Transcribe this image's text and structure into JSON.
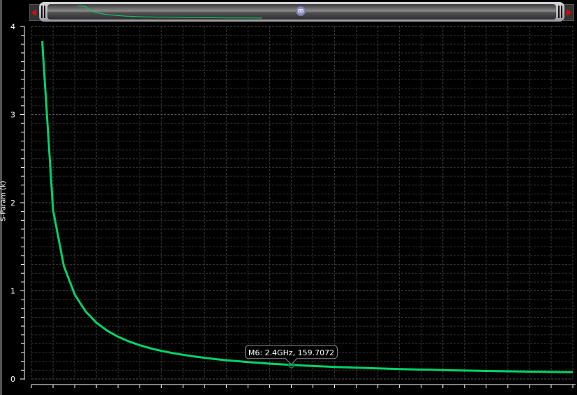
{
  "chart_data": {
    "type": "line",
    "title": "",
    "xlabel": "",
    "ylabel": "S-Param (k)",
    "xlim": [
      0,
      5
    ],
    "xunit": "GHz",
    "ylim": [
      0,
      4
    ],
    "yticks": [
      "0",
      "1",
      "2",
      "3",
      "4"
    ],
    "grid": true,
    "series": [
      {
        "name": "S-Param",
        "color": "#00d46a",
        "x": [
          0.1,
          0.2,
          0.3,
          0.4,
          0.5,
          0.6,
          0.7,
          0.8,
          0.9,
          1.0,
          1.1,
          1.2,
          1.3,
          1.4,
          1.5,
          1.6,
          1.7,
          1.8,
          1.9,
          2.0,
          2.1,
          2.2,
          2.3,
          2.4,
          2.5,
          2.6,
          2.7,
          2.8,
          2.9,
          3.0,
          3.1,
          3.2,
          3.3,
          3.4,
          3.5,
          3.6,
          3.7,
          3.8,
          3.9,
          4.0,
          4.1,
          4.2,
          4.3,
          4.4,
          4.5,
          4.6,
          4.7,
          4.8,
          4.9,
          5.0
        ],
        "values": [
          3.833,
          1.917,
          1.278,
          0.958,
          0.767,
          0.639,
          0.548,
          0.479,
          0.426,
          0.383,
          0.348,
          0.319,
          0.295,
          0.274,
          0.256,
          0.24,
          0.225,
          0.213,
          0.202,
          0.192,
          0.183,
          0.174,
          0.167,
          0.16,
          0.153,
          0.147,
          0.142,
          0.137,
          0.132,
          0.128,
          0.124,
          0.12,
          0.116,
          0.113,
          0.11,
          0.106,
          0.104,
          0.101,
          0.098,
          0.096,
          0.094,
          0.091,
          0.089,
          0.087,
          0.085,
          0.083,
          0.082,
          0.08,
          0.078,
          0.077
        ]
      }
    ],
    "marker": {
      "name": "M6",
      "x": 2.4,
      "y": 0.1597072,
      "label": "M6: 2.4GHz, 159.7072"
    }
  },
  "scrollbar": {
    "button_label": "m"
  }
}
